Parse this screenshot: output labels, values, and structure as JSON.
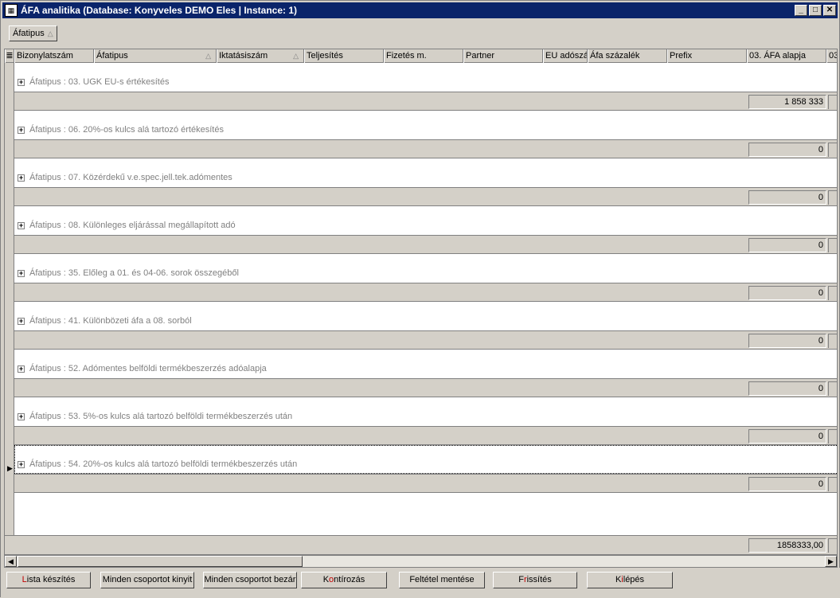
{
  "window": {
    "title": "ÁFA analitika  (Database: Konyveles DEMO  Eles | Instance: 1)",
    "icon": "app-icon",
    "minimize": "_",
    "maximize": "□",
    "close": "✕"
  },
  "groupbar": {
    "chip_label": "Áfatipus",
    "sort_symbol": "△"
  },
  "columns": [
    {
      "label": "Bizonylatszám",
      "sort": ""
    },
    {
      "label": "Áfatipus",
      "sort": "△"
    },
    {
      "label": "Iktatásiszám",
      "sort": "△"
    },
    {
      "label": "Teljesítés",
      "sort": ""
    },
    {
      "label": "Fizetés m.",
      "sort": ""
    },
    {
      "label": "Partner",
      "sort": ""
    },
    {
      "label": "EU adószá",
      "sort": ""
    },
    {
      "label": "Áfa százalék",
      "sort": ""
    },
    {
      "label": "Prefix",
      "sort": ""
    },
    {
      "label": "03. ÁFA alapja",
      "sort": ""
    },
    {
      "label": "03",
      "sort": ""
    }
  ],
  "groups": [
    {
      "label": "Áfatipus : 03. UGK EU-s értékesítés",
      "sum": "1 858 333"
    },
    {
      "label": "Áfatipus : 06. 20%-os kulcs alá tartozó értékesítés",
      "sum": "0"
    },
    {
      "label": "Áfatipus : 07. Közérdekű v.e.spec.jell.tek.adómentes",
      "sum": "0"
    },
    {
      "label": "Áfatipus : 08. Különleges eljárással megállapított adó",
      "sum": "0"
    },
    {
      "label": "Áfatipus : 35. Előleg a 01. és 04-06. sorok összegéből",
      "sum": "0"
    },
    {
      "label": "Áfatipus : 41. Különbözeti áfa a 08. sorból",
      "sum": "0"
    },
    {
      "label": "Áfatipus : 52. Adómentes belföldi termékbeszerzés adóalapja",
      "sum": "0"
    },
    {
      "label": "Áfatipus : 53. 5%-os kulcs alá tartozó belföldi termékbeszerzés után",
      "sum": "0"
    },
    {
      "label": "Áfatipus : 54. 20%-os kulcs alá tartozó belföldi termékbeszerzés után",
      "sum": "0"
    }
  ],
  "expander_symbol": "+",
  "grand_total": "1858333,00",
  "scrollbar": {
    "left": "◀",
    "right": "▶"
  },
  "buttons": {
    "lista_hot": "L",
    "lista_rest": "ista készítés",
    "expand_all": "Minden csoportot kinyit",
    "collapse_all": "Minden csoportot bezár",
    "kontir_pre": "K",
    "kontir_hot": "o",
    "kontir_rest": "ntírozás",
    "save_filter": "Feltétel mentése",
    "frissit_pre": "F",
    "frissit_hot": "r",
    "frissit_rest": "issítés",
    "kilep_pre": "K",
    "kilep_hot": "i",
    "kilep_rest": "lépés"
  }
}
